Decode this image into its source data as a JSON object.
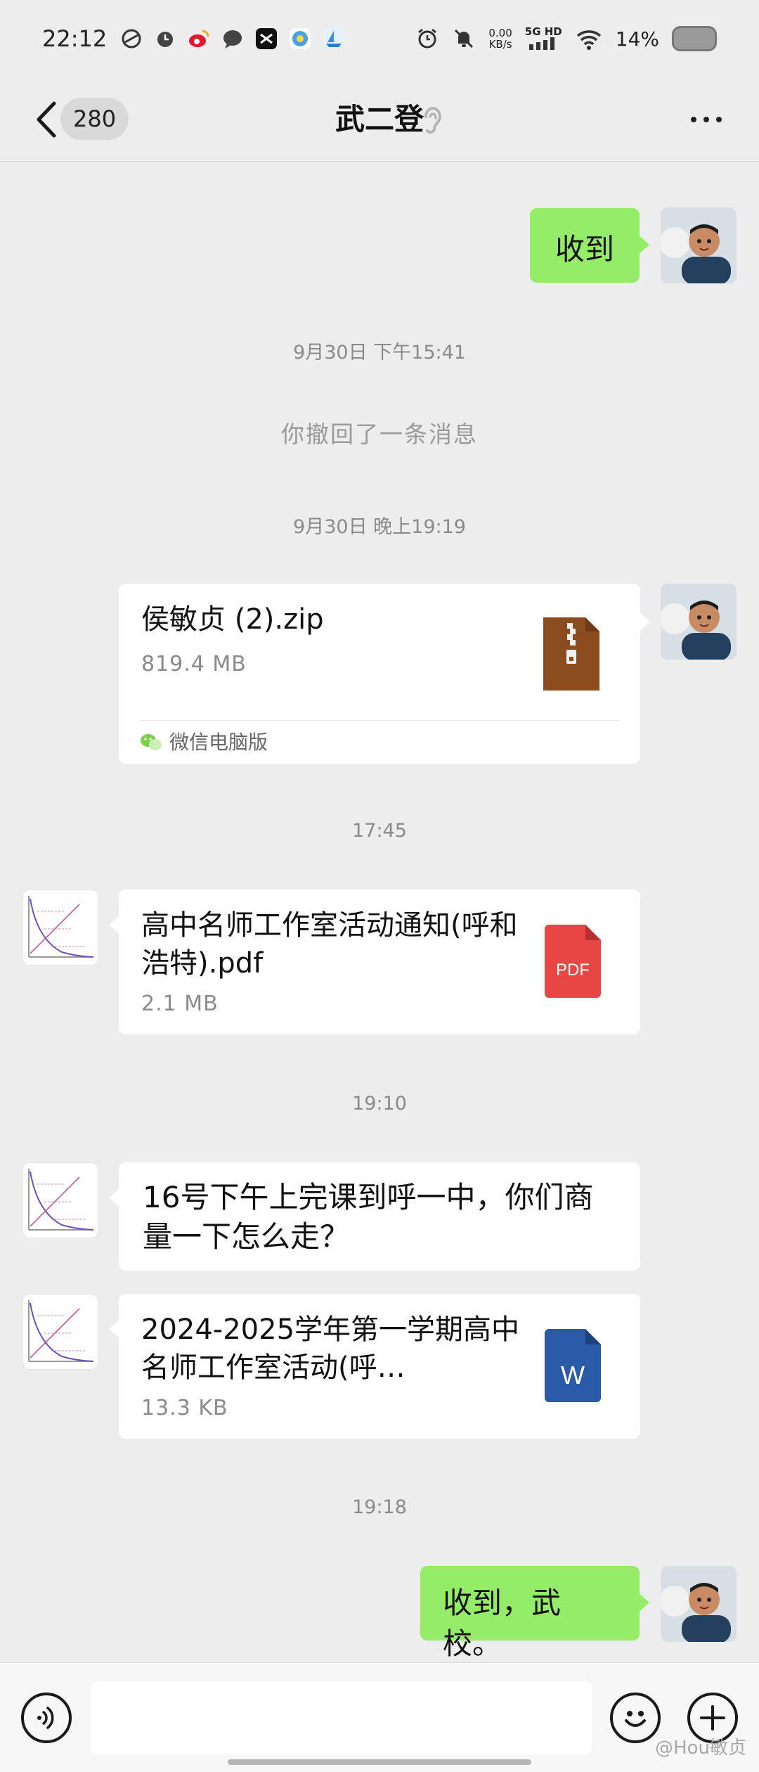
{
  "status_bar": {
    "time": "22:12",
    "net_speed_value": "0.00",
    "net_speed_unit": "KB/s",
    "network_type": "5G HD",
    "battery": "14%"
  },
  "header": {
    "unread_count": "280",
    "title": "武二登"
  },
  "messages": {
    "m1": {
      "text": "收到"
    },
    "ts1": "9月30日 下午15:41",
    "recall_note": "你撤回了一条消息",
    "ts2": "9月30日 晚上19:19",
    "m2": {
      "file_name": "侯敏贞 (2).zip",
      "file_size": "819.4 MB",
      "source": "微信电脑版"
    },
    "ts3": "17:45",
    "m3": {
      "file_name": "高中名师工作室活动通知(呼和浩特).pdf",
      "file_size": "2.1 MB",
      "badge": "PDF"
    },
    "ts4": "19:10",
    "m4": {
      "text": "16号下午上完课到呼一中，你们商量一下怎么走？"
    },
    "m5": {
      "file_name": "2024-2025学年第一学期高中名师工作室活动(呼…",
      "file_size": "13.3 KB",
      "badge": "W"
    },
    "ts5": "19:18",
    "m6": {
      "text": "收到，武校。"
    }
  },
  "watermark": "@Hou敏贞",
  "colors": {
    "chat_bg": "#ededed",
    "self_bubble": "#95ec69",
    "other_bubble": "#ffffff",
    "zip_icon": "#8b4d1f",
    "pdf_icon": "#e84545",
    "word_icon": "#2b5aa8"
  },
  "icons": {
    "back": "chevron-left-icon",
    "ear": "ear-icon",
    "more": "more-dots-icon",
    "voice": "voice-icon",
    "emoji": "emoji-icon",
    "plus": "plus-icon"
  }
}
